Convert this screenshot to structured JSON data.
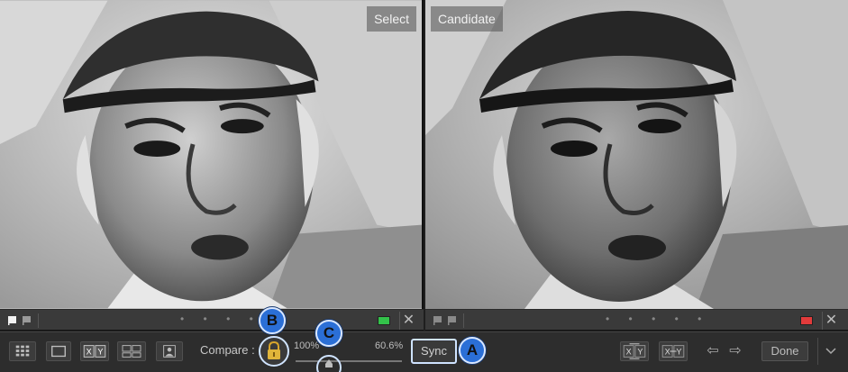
{
  "panes": {
    "left_label": "Select",
    "right_label": "Candidate"
  },
  "strips": {
    "dots": "• • • • •",
    "left_color_label": "#33c24a",
    "right_color_label": "#e23b3b",
    "close_glyph": "✕"
  },
  "toolbar": {
    "compare_label": "Compare :",
    "amount_left": "100%",
    "amount_right": "60.6%",
    "sync_label": "Sync",
    "done_label": "Done",
    "prev_glyph": "⇦",
    "next_glyph": "⇨"
  },
  "callouts": {
    "a": "A",
    "b": "B",
    "c": "C"
  },
  "colors": {
    "callout_fill": "#2b6fd6",
    "highlight_ring": "#cfe3ff"
  }
}
